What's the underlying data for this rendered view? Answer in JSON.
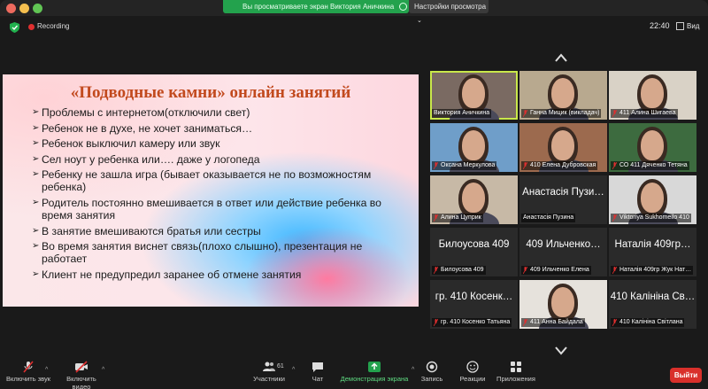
{
  "window": {
    "share_banner": "Вы просматриваете экран Виктория Аничкина",
    "view_settings": "Настройки просмотра",
    "recording_label": "Recording",
    "clock": "22:40",
    "view_button": "Вид"
  },
  "slide": {
    "title": "«Подводные камни» онлайн занятий",
    "bullets": [
      "Проблемы с интернетом(отключили свет)",
      "Ребенок не в духе, не хочет заниматься…",
      "Ребенок выключил камеру или звук",
      "Сел ноут у ребенка  или…. даже у логопеда",
      "Ребенку не зашла игра (бывает оказывается не по возможностям ребенка)",
      "Родитель постоянно вмешивается в ответ или действие ребенка во время занятия",
      "В занятие вмешиваются братья или сестры",
      "Во время занятия виснет связь(плохо слышно), презентация не работает",
      "Клиент не предупредил заранее об отмене занятия"
    ]
  },
  "gallery": {
    "tiles": [
      {
        "caption": "Виктория Аничкина",
        "big": "",
        "video": true,
        "muted": false,
        "active": true,
        "bg": "#7a6a62"
      },
      {
        "caption": "Ганна Мицик (викладач)",
        "big": "",
        "video": true,
        "muted": true,
        "active": false,
        "bg": "#b8a98f"
      },
      {
        "caption": "411 Алина Шигаева",
        "big": "",
        "video": true,
        "muted": true,
        "active": false,
        "bg": "#d9d2c6"
      },
      {
        "caption": "Оксана Меркулова",
        "big": "",
        "video": true,
        "muted": true,
        "active": false,
        "bg": "#6f9ec9"
      },
      {
        "caption": "410 Елена Дубровская",
        "big": "",
        "video": true,
        "muted": true,
        "active": false,
        "bg": "#9c6a4e"
      },
      {
        "caption": "СО 411 Дяченко Тетяна",
        "big": "",
        "video": true,
        "muted": true,
        "active": false,
        "bg": "#3d6b3f"
      },
      {
        "caption": "Алина Цуприк",
        "big": "",
        "video": true,
        "muted": true,
        "active": false,
        "bg": "#c7b9a6"
      },
      {
        "caption": "Анастасія Пузина",
        "big": "Анастасія Пузи…",
        "video": false,
        "muted": false,
        "active": false,
        "bg": "#2a2a2a"
      },
      {
        "caption": "Viktoriya Sukhomeilo 410",
        "big": "",
        "video": true,
        "muted": true,
        "active": false,
        "bg": "#d8d8d8"
      },
      {
        "caption": "Билоусова 409",
        "big": "Билоусова 409",
        "video": false,
        "muted": true,
        "active": false,
        "bg": "#2a2a2a"
      },
      {
        "caption": "409 Ильченко Елена",
        "big": "409 Ильченко…",
        "video": false,
        "muted": true,
        "active": false,
        "bg": "#2a2a2a"
      },
      {
        "caption": "Наталія 409гр Жук Нат…",
        "big": "Наталія 409гр…",
        "video": false,
        "muted": true,
        "active": false,
        "bg": "#2a2a2a"
      },
      {
        "caption": "гр. 410 Косенко Татьяна",
        "big": "гр. 410 Косенк…",
        "video": false,
        "muted": true,
        "active": false,
        "bg": "#2a2a2a"
      },
      {
        "caption": "411 Анна Байдала",
        "big": "",
        "video": true,
        "muted": true,
        "active": false,
        "bg": "#e6e2dc"
      },
      {
        "caption": "410 Калініна Світлана",
        "big": "410 Калініна Св…",
        "video": false,
        "muted": true,
        "active": false,
        "bg": "#2a2a2a"
      }
    ]
  },
  "toolbar": {
    "audio": "Включить звук",
    "video": "Включить видео",
    "participants": "Участники",
    "participants_count": "61",
    "chat": "Чат",
    "share": "Демонстрация экрана",
    "record": "Запись",
    "reactions": "Реакции",
    "apps": "Приложения",
    "leave": "Выйти"
  },
  "colors": {
    "share_green": "#23a24d",
    "slide_title": "#c24a1e",
    "active_border": "#c9e84a",
    "leave_red": "#d9302b",
    "mute_red": "#e02f2f"
  }
}
